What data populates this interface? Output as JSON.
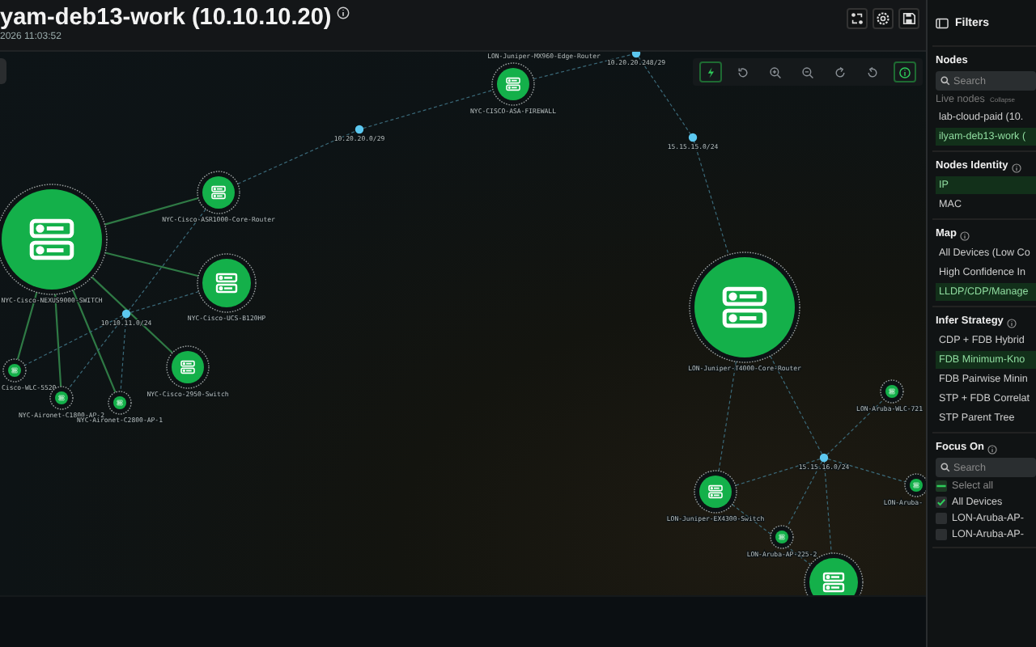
{
  "header": {
    "title": "yam-deb13-work (10.10.10.20)",
    "timestamp": "2026 11:03:52"
  },
  "toolbar": [
    {
      "kind": "bolt",
      "on": true
    },
    {
      "kind": "reset",
      "on": false
    },
    {
      "kind": "zoom-in",
      "on": false
    },
    {
      "kind": "zoom-out",
      "on": false
    },
    {
      "kind": "rotate-right",
      "on": false
    },
    {
      "kind": "rotate-left",
      "on": false
    },
    {
      "kind": "info",
      "on": true
    }
  ],
  "graph": {
    "nodes": [
      {
        "kind": "small",
        "label": "NYC-CISCO-ASA-FIREWALL"
      },
      {
        "kind": "subnet",
        "label": "10.20.20.0/29"
      },
      {
        "kind": "small",
        "label": "NYC-Cisco-ASR1000-Core-Router"
      },
      {
        "kind": "large",
        "label": "NYC-Cisco-NEXUS9000-SWITCH"
      },
      {
        "kind": "medium",
        "label": "NYC-Cisco-UCS-B120HP"
      },
      {
        "kind": "subnet",
        "label": "10.10.11.0/24"
      },
      {
        "kind": "small",
        "label": "NYC-Cisco-2950-Switch"
      },
      {
        "kind": "tiny",
        "label": "Cisco-WLC-5520"
      },
      {
        "kind": "tiny",
        "label": "NYC-Aironet-C1800-AP-2"
      },
      {
        "kind": "tiny",
        "label": "NYC-Aironet-C2800-AP-1"
      },
      {
        "kind": "label",
        "label": "LON-Juniper-MX960-Edge-Router"
      },
      {
        "kind": "subnet",
        "label": "10.20.20.248/29"
      },
      {
        "kind": "subnet",
        "label": "15.15.15.0/24"
      },
      {
        "kind": "large",
        "label": "LON-Juniper-T4000-Core-Router"
      },
      {
        "kind": "subnet",
        "label": "15.15.16.0/24"
      },
      {
        "kind": "small",
        "label": "LON-Juniper-EX4300-Switch"
      },
      {
        "kind": "tiny",
        "label": "LON-Aruba-AP-225-2"
      },
      {
        "kind": "tiny",
        "label": "LON-Aruba-WLC-721"
      },
      {
        "kind": "tiny",
        "label": "LON-Aruba-"
      },
      {
        "kind": "medium"
      }
    ]
  },
  "filters": {
    "title": "Filters",
    "nodes": {
      "title": "Nodes",
      "search_placeholder": "Search",
      "live_label": "Live nodes",
      "collapse": "Collapse",
      "items": [
        {
          "label": "lab-cloud-paid (10.",
          "selected": false
        },
        {
          "label": "ilyam-deb13-work (",
          "selected": true
        }
      ]
    },
    "sections": [
      {
        "title": "Nodes Identity",
        "items": [
          {
            "label": "IP",
            "selected": true
          },
          {
            "label": "MAC",
            "selected": false
          }
        ]
      },
      {
        "title": "Map",
        "items": [
          {
            "label": "All Devices (Low Co",
            "selected": false
          },
          {
            "label": "High Confidence In",
            "selected": false
          },
          {
            "label": "LLDP/CDP/Manage",
            "selected": true
          }
        ]
      },
      {
        "title": "Infer Strategy",
        "items": [
          {
            "label": "CDP + FDB Hybrid",
            "selected": false
          },
          {
            "label": "FDB Minimum-Kno",
            "selected": true
          },
          {
            "label": "FDB Pairwise Minin",
            "selected": false
          },
          {
            "label": "STP + FDB Correlat",
            "selected": false
          },
          {
            "label": "STP Parent Tree",
            "selected": false
          }
        ]
      }
    ],
    "focus": {
      "title": "Focus On",
      "search_placeholder": "Search",
      "items": [
        {
          "label": "Select all",
          "checked": false,
          "indeterminate": true
        },
        {
          "label": "All Devices",
          "checked": true,
          "indeterminate": false
        },
        {
          "label": "LON-Aruba-AP-",
          "checked": false,
          "indeterminate": false
        },
        {
          "label": "LON-Aruba-AP-",
          "checked": false,
          "indeterminate": false
        }
      ]
    }
  }
}
